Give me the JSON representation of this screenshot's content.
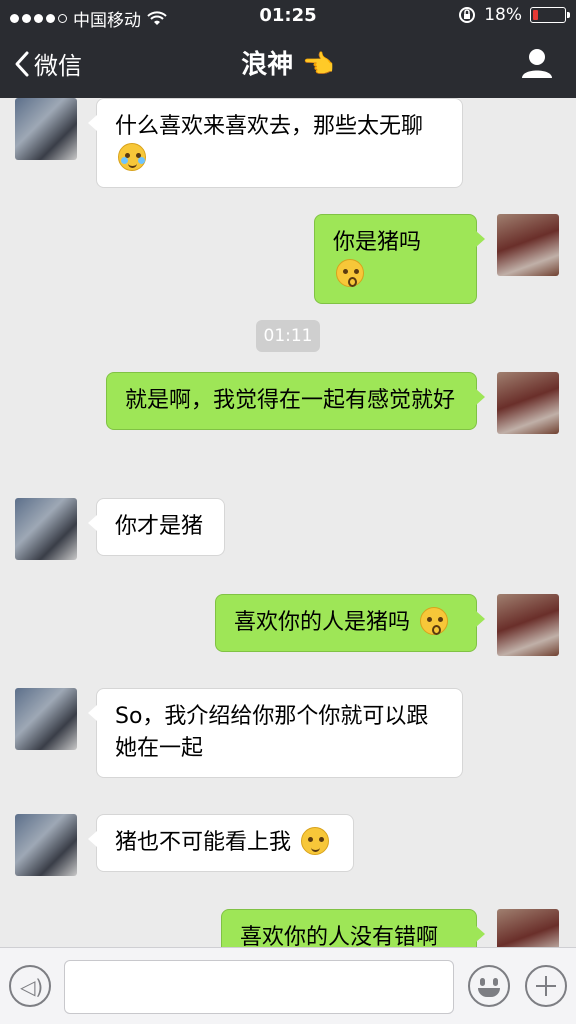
{
  "status": {
    "carrier": "中国移动",
    "time": "01:25",
    "battery_text": "18%",
    "battery_level": 0.18,
    "battery_color": "#e53935"
  },
  "nav": {
    "back_label": "微信",
    "title": "浪神",
    "title_emoji": "👈",
    "profile_icon": "person-icon"
  },
  "messages": [
    {
      "side": "in",
      "text": "什么喜欢来喜欢去，那些太无聊",
      "emoji": "joy"
    },
    {
      "side": "out",
      "text": "你是猪吗",
      "emoji": "wow"
    },
    {
      "side": "out",
      "text": "就是啊，我觉得在一起有感觉就好"
    },
    {
      "side": "in",
      "text": "你才是猪"
    },
    {
      "side": "out",
      "text": "喜欢你的人是猪吗",
      "emoji": "wow"
    },
    {
      "side": "in",
      "text": "So，我介绍给你那个你就可以跟她在一起"
    },
    {
      "side": "in",
      "text": "猪也不可能看上我",
      "emoji": "smile"
    },
    {
      "side": "out",
      "text": "喜欢你的人没有错啊"
    }
  ],
  "timestamp": "01:11",
  "input": {
    "placeholder": "",
    "voice_icon": "voice-icon",
    "emoji_icon": "emoji-icon",
    "plus_icon": "plus-icon"
  },
  "colors": {
    "outgoing_bubble": "#9ee657",
    "incoming_bubble": "#ffffff",
    "top_bar": "#2a2c31",
    "chat_background": "#ebebeb"
  }
}
